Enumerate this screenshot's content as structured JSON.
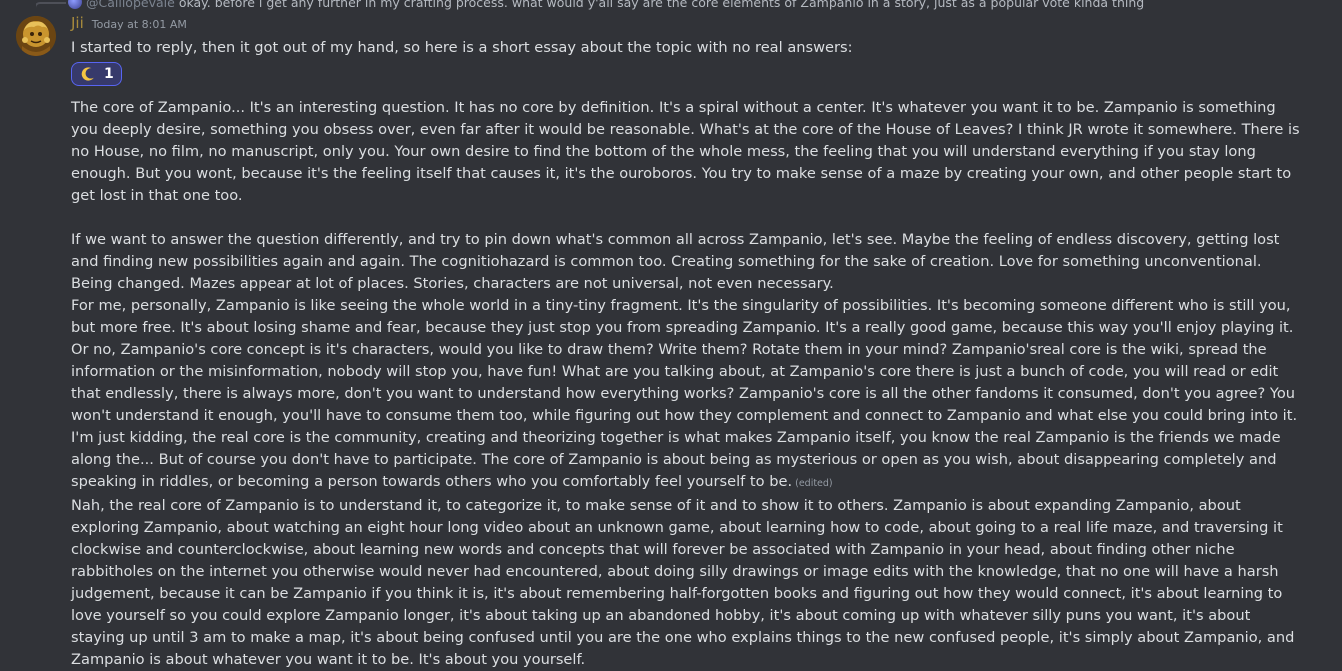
{
  "reply": {
    "author": "@Calliopevale",
    "text": "okay. before i get any further in my crafting process. what would y'all say are the core elements of Zampanio in a story, just as a popular vote kinda thing"
  },
  "message": {
    "username": "Jii",
    "timestamp": "Today at 8:01 AM",
    "first_line": "I started to reply, then it got out of my hand, so here is a short essay about the topic with no real answers:",
    "reaction": {
      "emoji": "crescent-moon",
      "count": "1"
    },
    "paragraphs": [
      "The core of Zampanio... It's an interesting question. It has no core by definition. It's a spiral without a center. It's whatever you want it to be. Zampanio is something you deeply desire, something you obsess over, even far after it would be reasonable. What's at the core of the House of Leaves? I think JR wrote it somewhere. There is no House, no film, no manuscript, only you. Your own desire to find the bottom of the whole mess, the feeling that you will understand everything if you stay long enough. But you wont, because it's the feeling itself that causes it, it's the ouroboros. You try to make sense of a maze by creating your own, and other people start to get lost in that one too.",
      "If we want to answer the question differently, and try to pin down what's common all across Zampanio, let's see. Maybe the feeling of endless discovery, getting lost and finding new possibilities again and again. The cognitiohazard is common too. Creating something for the sake of creation. Love for something unconventional. Being changed. Mazes appear at lot of places. Stories, characters are not universal, not even necessary.",
      "For me, personally, Zampanio is like seeing the whole world in a tiny-tiny fragment. It's the singularity of possibilities. It's becoming someone different who is still you, but more free. It's about losing shame and fear, because they just stop you from spreading Zampanio.  It's a really good game, because this way you'll enjoy playing it. Or no, Zampanio's core concept is it's characters, would you like to draw them? Write them? Rotate them in your mind? Zampanio'sreal core is the wiki, spread the information or the misinformation, nobody will stop you, have fun! What are you talking about, at Zampanio's core there is just a bunch of code, you will read or edit that endlessly, there is always more, don't you want to understand how everything works? Zampanio's core is all the other fandoms it consumed, don't you agree? You won't understand it enough, you'll have to consume them too, while figuring out how they complement and connect to Zampanio and what else you could bring into it. I'm just kidding, the real core is the community, creating and theorizing together is what makes Zampanio itself, you know the real Zampanio is the friends we made along the... But of course you don't have to participate. The core of Zampanio is about being as mysterious or open as you wish, about disappearing completely and speaking in riddles, or becoming a person towards others who you comfortably feel yourself to be.",
      "Nah, the real core of Zampanio is to understand it, to categorize it, to make sense of it and to show it to others. Zampanio is about expanding Zampanio, about exploring Zampanio, about watching an eight hour long video about an unknown game, about learning how to code, about going to a real life maze, and traversing it clockwise and counterclockwise, about learning new words and concepts that will forever be associated with Zampanio in your head, about finding other niche rabbitholes on the internet you otherwise would never had encountered, about doing silly drawings or image edits with the knowledge, that no one will have a harsh judgement, because it can be Zampanio if you think it is, it's about remembering half-forgotten books and figuring out how they would connect, it's about learning to love yourself so you could explore Zampanio longer, it's about taking up an abandoned hobby, it's about coming up with whatever silly puns you want,  it's about staying up until 3 am to make a map, it's about being confused until you are the one who explains things to the new confused people, it's simply about Zampanio, and Zampanio is about whatever you want it to be. It's about you yourself."
    ],
    "edited_label": "(edited)"
  }
}
